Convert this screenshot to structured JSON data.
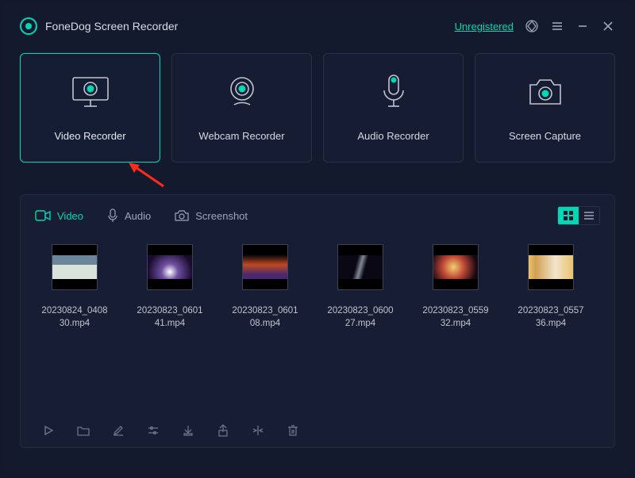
{
  "header": {
    "app_title": "FoneDog Screen Recorder",
    "unregistered_label": "Unregistered"
  },
  "modes": {
    "video": "Video Recorder",
    "webcam": "Webcam Recorder",
    "audio": "Audio Recorder",
    "capture": "Screen Capture"
  },
  "tabs": {
    "video": "Video",
    "audio": "Audio",
    "screenshot": "Screenshot"
  },
  "files": [
    {
      "name": "20230824_0408\n30.mp4"
    },
    {
      "name": "20230823_0601\n41.mp4"
    },
    {
      "name": "20230823_0601\n08.mp4"
    },
    {
      "name": "20230823_0600\n27.mp4"
    },
    {
      "name": "20230823_0559\n32.mp4"
    },
    {
      "name": "20230823_0557\n36.mp4"
    }
  ]
}
